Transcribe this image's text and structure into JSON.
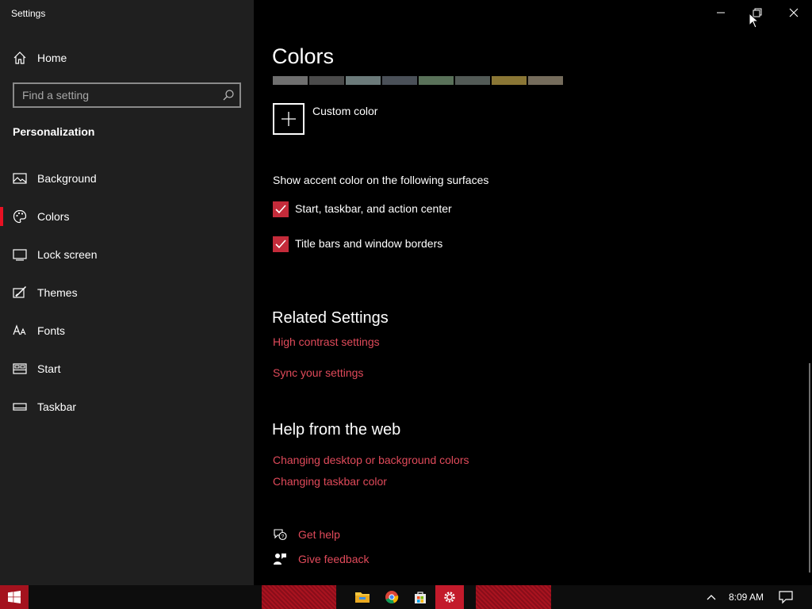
{
  "window": {
    "title": "Settings"
  },
  "sidebar": {
    "home_label": "Home",
    "search_placeholder": "Find a setting",
    "section_title": "Personalization",
    "items": [
      {
        "label": "Background",
        "icon": "picture-icon"
      },
      {
        "label": "Colors",
        "icon": "palette-icon",
        "active": true
      },
      {
        "label": "Lock screen",
        "icon": "lock-screen-icon"
      },
      {
        "label": "Themes",
        "icon": "paintbrush-icon"
      },
      {
        "label": "Fonts",
        "icon": "fonts-icon"
      },
      {
        "label": "Start",
        "icon": "start-icon"
      },
      {
        "label": "Taskbar",
        "icon": "taskbar-icon"
      }
    ]
  },
  "main": {
    "title": "Colors",
    "swatches": [
      "#6f6f6f",
      "#4b4b4b",
      "#6b7a7a",
      "#4a5058",
      "#597159",
      "#525a56",
      "#8a7635",
      "#756c5c"
    ],
    "custom_color_label": "Custom color",
    "surfaces_label": "Show accent color on the following surfaces",
    "checkboxes": [
      {
        "label": "Start, taskbar, and action center",
        "checked": true
      },
      {
        "label": "Title bars and window borders",
        "checked": true
      }
    ],
    "related_title": "Related Settings",
    "related_links": [
      "High contrast settings",
      "Sync your settings"
    ],
    "help_title": "Help from the web",
    "help_links": [
      "Changing desktop or background colors",
      "Changing taskbar color"
    ],
    "get_help": "Get help",
    "give_feedback": "Give feedback"
  },
  "taskbar": {
    "clock": "8:09 AM",
    "accent": "#c42b3a"
  }
}
